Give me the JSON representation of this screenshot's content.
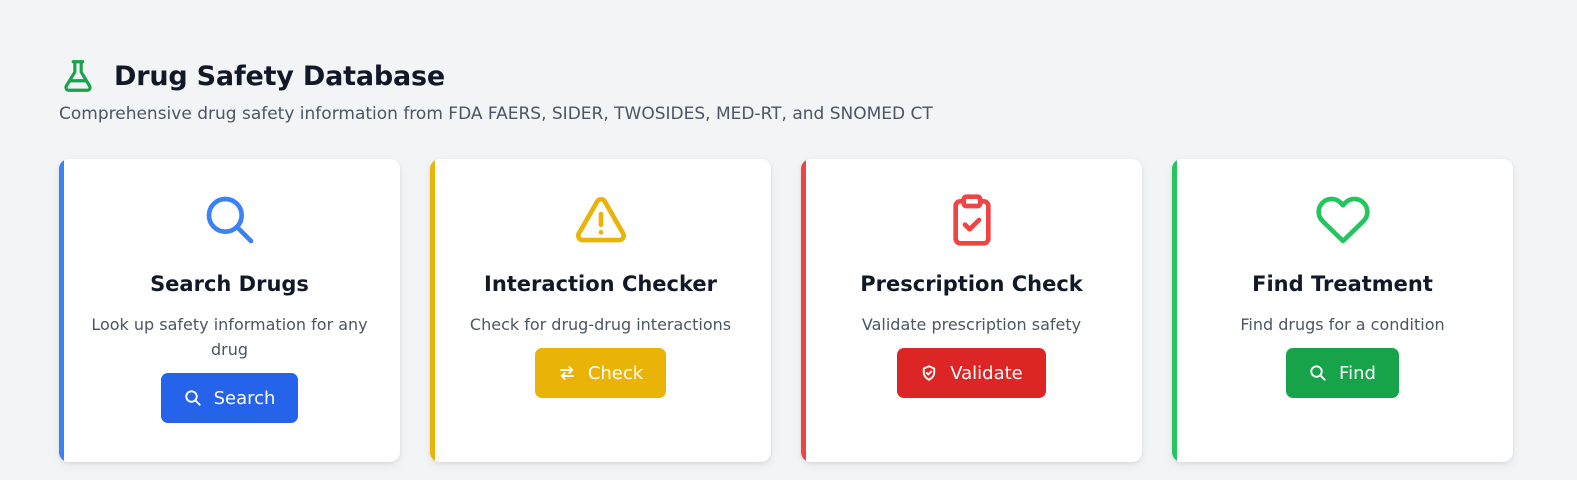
{
  "header": {
    "title": "Drug Safety Database",
    "subtitle": "Comprehensive drug safety information from FDA FAERS, SIDER, TWOSIDES, MED-RT, and SNOMED CT",
    "icon": "flask-icon"
  },
  "cards": [
    {
      "title": "Search Drugs",
      "description": "Look up safety information for any drug",
      "button_label": "Search",
      "icon": "search-icon",
      "button_icon": "search-icon",
      "accent": "#3b82f6",
      "button_color": "#2563eb"
    },
    {
      "title": "Interaction Checker",
      "description": "Check for drug-drug interactions",
      "button_label": "Check",
      "icon": "warning-triangle-icon",
      "button_icon": "swap-arrows-icon",
      "accent": "#eab308",
      "button_color": "#eab308"
    },
    {
      "title": "Prescription Check",
      "description": "Validate prescription safety",
      "button_label": "Validate",
      "icon": "clipboard-check-icon",
      "button_icon": "shield-check-icon",
      "accent": "#ef4444",
      "button_color": "#dc2626"
    },
    {
      "title": "Find Treatment",
      "description": "Find drugs for a condition",
      "button_label": "Find",
      "icon": "heart-icon",
      "button_icon": "search-icon",
      "accent": "#22c55e",
      "button_color": "#16a34a"
    }
  ]
}
